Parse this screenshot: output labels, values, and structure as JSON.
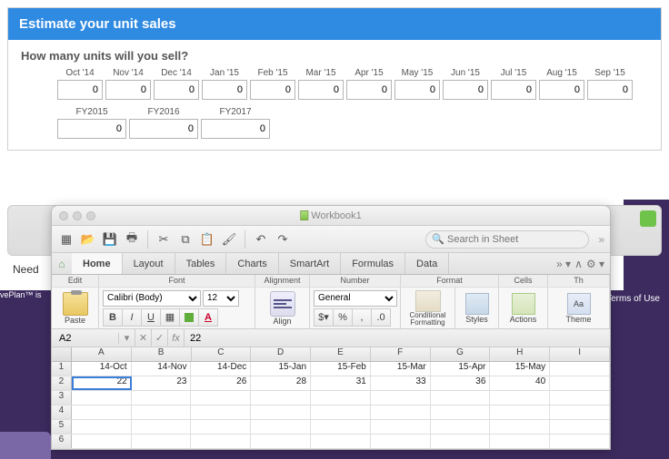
{
  "panel": {
    "title": "Estimate your unit sales",
    "question": "How many units will you sell?",
    "months": [
      "Oct '14",
      "Nov '14",
      "Dec '14",
      "Jan '15",
      "Feb '15",
      "Mar '15",
      "Apr '15",
      "May '15",
      "Jun '15",
      "Jul '15",
      "Aug '15",
      "Sep '15"
    ],
    "month_values": [
      "0",
      "0",
      "0",
      "0",
      "0",
      "0",
      "0",
      "0",
      "0",
      "0",
      "0",
      "0"
    ],
    "fy_labels": [
      "FY2015",
      "FY2016",
      "FY2017"
    ],
    "fy_values": [
      "0",
      "0",
      "0"
    ]
  },
  "need": "Need",
  "footer": "Terms of Use",
  "trademark": "vePlan™ is",
  "excel": {
    "title": "Workbook1",
    "search_placeholder": "Search in Sheet",
    "tabs": [
      "Home",
      "Layout",
      "Tables",
      "Charts",
      "SmartArt",
      "Formulas",
      "Data"
    ],
    "ribbon_groups": [
      "Edit",
      "Font",
      "Alignment",
      "Number",
      "Format",
      "Cells",
      "Th"
    ],
    "paste_label": "Paste",
    "align_label": "Align",
    "font_name": "Calibri (Body)",
    "font_size": "12",
    "number_format": "General",
    "cond_label": "Conditional Formatting",
    "styles_label": "Styles",
    "actions_label": "Actions",
    "theme_label": "Theme",
    "cell_ref": "A2",
    "formula_value": "22",
    "columns": [
      "A",
      "B",
      "C",
      "D",
      "E",
      "F",
      "G",
      "H",
      "I"
    ],
    "row1": [
      "14-Oct",
      "14-Nov",
      "14-Dec",
      "15-Jan",
      "15-Feb",
      "15-Mar",
      "15-Apr",
      "15-May",
      ""
    ],
    "row2": [
      "22",
      "23",
      "26",
      "28",
      "31",
      "33",
      "36",
      "40",
      ""
    ],
    "rownums": [
      "1",
      "2",
      "3",
      "4",
      "5",
      "6"
    ]
  }
}
